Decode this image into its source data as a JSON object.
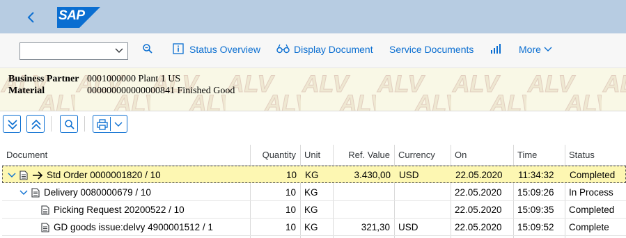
{
  "shell": {
    "logo_text": "SAP",
    "logo_color": "#0a6ed1",
    "back_icon": "chevron-left-icon"
  },
  "toolbar": {
    "variant_select_value": "",
    "search_icon": "zoom-icon",
    "status_overview_label": "Status Overview",
    "display_document_label": "Display Document",
    "service_documents_label": "Service Documents",
    "chart_icon": "bar-chart-icon",
    "more_label": "More"
  },
  "header": {
    "business_partner_label": "Business Partner",
    "business_partner_value": "0001000000 Plant 1 US",
    "material_label": "Material",
    "material_value": "000000000000000841 Finished Good",
    "watermark_text": "ALV"
  },
  "alv_toolbar": {
    "buttons": [
      "expand-all-icon",
      "collapse-all-icon",
      "find-icon",
      "print-icon",
      "dropdown-icon"
    ]
  },
  "table": {
    "columns": [
      "Document",
      "Quantity",
      "Unit",
      "Ref. Value",
      "Currency",
      "On",
      "Time",
      "Status"
    ],
    "rows": [
      {
        "document": "Std Order 0000001820 / 10",
        "quantity": "10",
        "unit": "KG",
        "ref_value": "3.430,00",
        "currency": "USD",
        "on": "22.05.2020",
        "time": "11:34:32",
        "status": "Completed"
      },
      {
        "document": "Delivery 0080000679 / 10",
        "quantity": "10",
        "unit": "KG",
        "ref_value": "",
        "currency": "",
        "on": "22.05.2020",
        "time": "15:09:26",
        "status": "In Process"
      },
      {
        "document": "Picking Request 20200522 / 10",
        "quantity": "10",
        "unit": "KG",
        "ref_value": "",
        "currency": "",
        "on": "22.05.2020",
        "time": "15:09:35",
        "status": "Completed"
      },
      {
        "document": "GD goods issue:delvy 4900001512 / 1",
        "quantity": "10",
        "unit": "KG",
        "ref_value": "321,30",
        "currency": "USD",
        "on": "22.05.2020",
        "time": "15:09:52",
        "status": "Complete"
      }
    ]
  },
  "colors": {
    "accent": "#0a6ed1",
    "shell_bg": "#b7cce2",
    "selected_row_bg": "#fdf7b2",
    "header_panel_bg": "#f9f8e6"
  }
}
